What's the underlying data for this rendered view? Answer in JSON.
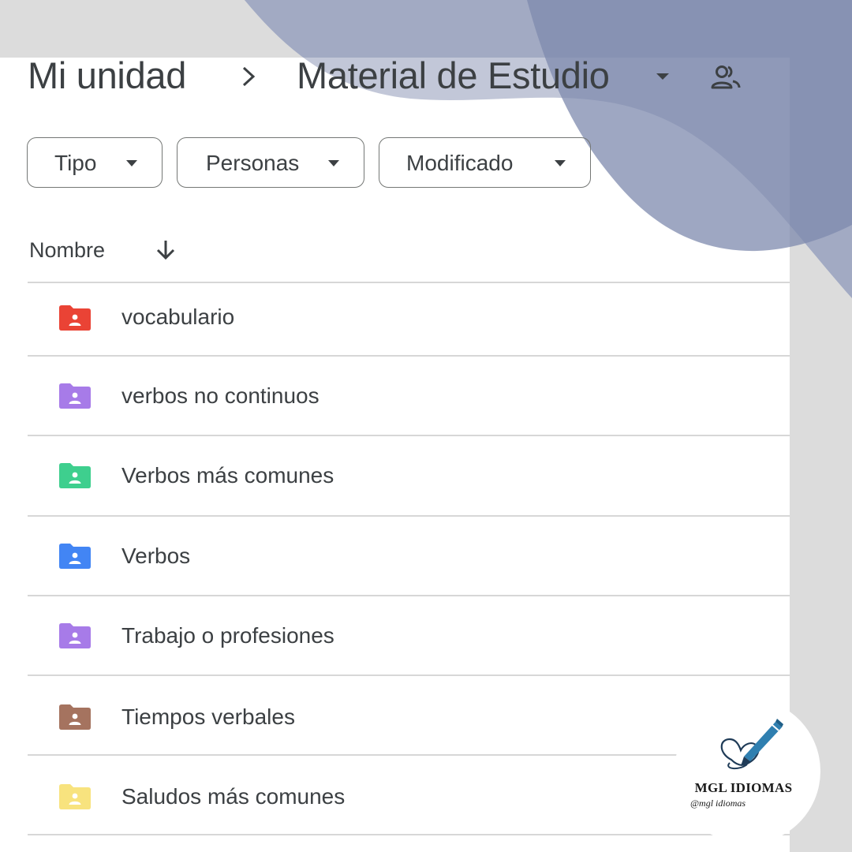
{
  "breadcrumb": {
    "root": "Mi unidad",
    "current": "Material de Estudio"
  },
  "icons": {
    "separator": "chevron-right-icon",
    "caret": "caret-down-icon",
    "shared": "people-icon",
    "sort": "arrow-down-icon",
    "folder": "shared-folder-icon"
  },
  "filters": [
    {
      "label": "Tipo"
    },
    {
      "label": "Personas"
    },
    {
      "label": "Modificado"
    }
  ],
  "list": {
    "column_header": "Nombre",
    "sort_direction": "descending",
    "items": [
      {
        "name": "vocabulario",
        "color": "#ea4335"
      },
      {
        "name": "verbos no continuos",
        "color": "#a77be8"
      },
      {
        "name": "Verbos más comunes",
        "color": "#3ecf8e"
      },
      {
        "name": "Verbos",
        "color": "#4285f4"
      },
      {
        "name": "Trabajo o profesiones",
        "color": "#a77be8"
      },
      {
        "name": "Tiempos verbales",
        "color": "#a5735f"
      },
      {
        "name": "Saludos más comunes",
        "color": "#f8e37e"
      }
    ]
  },
  "brand": {
    "name": "MGL IDIOMAS",
    "handle": "@mgl idiomas",
    "accent": "#2f7fb0"
  },
  "colors": {
    "background": "#dcdcdc",
    "shape_light": "#b8bfd1",
    "shape_dark": "#8c96b5",
    "shape_mid": "#a3adcc"
  }
}
